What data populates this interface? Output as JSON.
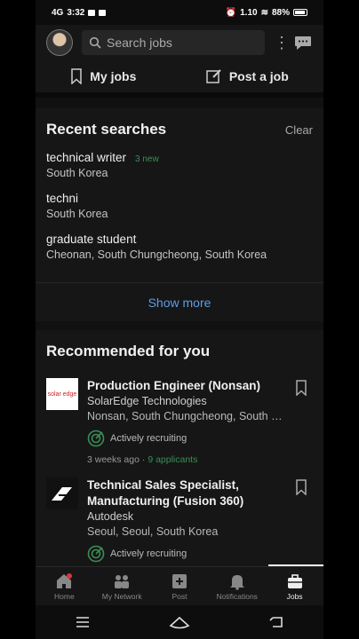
{
  "status_bar": {
    "network": "4G",
    "time": "3:32",
    "speed": "1.10",
    "battery": "88%"
  },
  "search": {
    "placeholder": "Search jobs"
  },
  "jobs_bar": {
    "my_jobs": "My jobs",
    "post_job": "Post a job"
  },
  "recent_searches": {
    "title": "Recent searches",
    "clear": "Clear",
    "items": [
      {
        "query": "technical writer",
        "badge": "3 new",
        "location": "South Korea"
      },
      {
        "query": "techni",
        "badge": "",
        "location": "South Korea"
      },
      {
        "query": "graduate student",
        "badge": "",
        "location": "Cheonan, South Chungcheong, South Korea"
      }
    ],
    "show_more": "Show more"
  },
  "recommended": {
    "title": "Recommended for you",
    "jobs": [
      {
        "title": "Production Engineer (Nonsan)",
        "company": "SolarEdge Technologies",
        "location": "Nonsan, South Chungcheong, South K...",
        "recruiting": "Actively recruiting",
        "posted": "3 weeks ago",
        "applicants": "9 applicants",
        "logo_text": "solar edge"
      },
      {
        "title": "Technical Sales Specialist, Manufacturing (Fusion 360)",
        "company": "Autodesk",
        "location": "Seoul, Seoul, South Korea",
        "recruiting": "Actively recruiting"
      }
    ]
  },
  "bottom_nav": [
    {
      "label": "Home",
      "icon": "home-icon"
    },
    {
      "label": "My Network",
      "icon": "network-icon"
    },
    {
      "label": "Post",
      "icon": "post-icon"
    },
    {
      "label": "Notifications",
      "icon": "bell-icon"
    },
    {
      "label": "Jobs",
      "icon": "briefcase-icon",
      "active": true
    }
  ],
  "colors": {
    "accent_blue": "#5b9ee8",
    "green": "#3a8f55",
    "background": "#161616"
  }
}
